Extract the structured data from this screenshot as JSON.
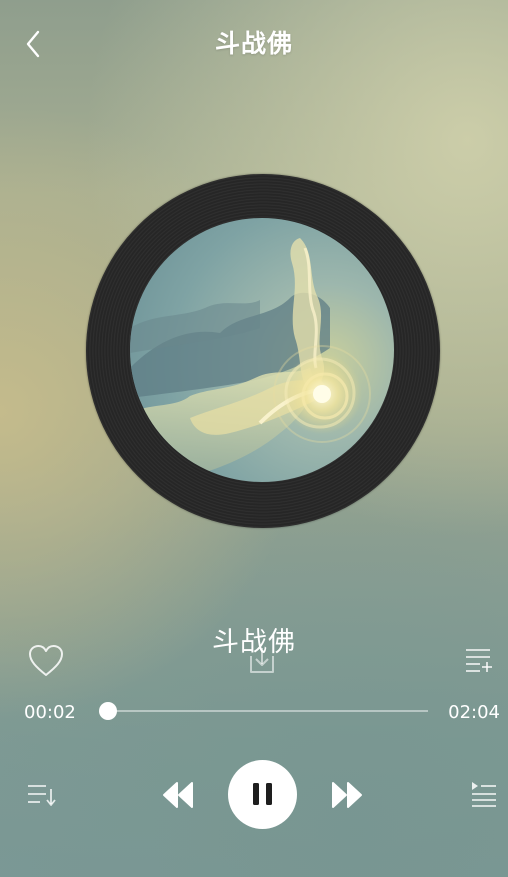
{
  "header": {
    "title": "斗战佛",
    "back_icon": "chevron-left-icon"
  },
  "player": {
    "song_title": "斗战佛",
    "current_time": "00:02",
    "total_time": "02:04",
    "progress": 0.016,
    "is_playing": true,
    "liked": false
  },
  "icons": {
    "like": "heart-icon",
    "download": "download-icon",
    "add_to_playlist": "playlist-add-icon",
    "sort": "list-sort-icon",
    "previous": "rewind-icon",
    "play_pause": "pause-icon",
    "next": "fast-forward-icon",
    "queue": "playlist-queue-icon"
  },
  "colors": {
    "accent": "#ffffff",
    "disc": "#2a2a2a"
  }
}
